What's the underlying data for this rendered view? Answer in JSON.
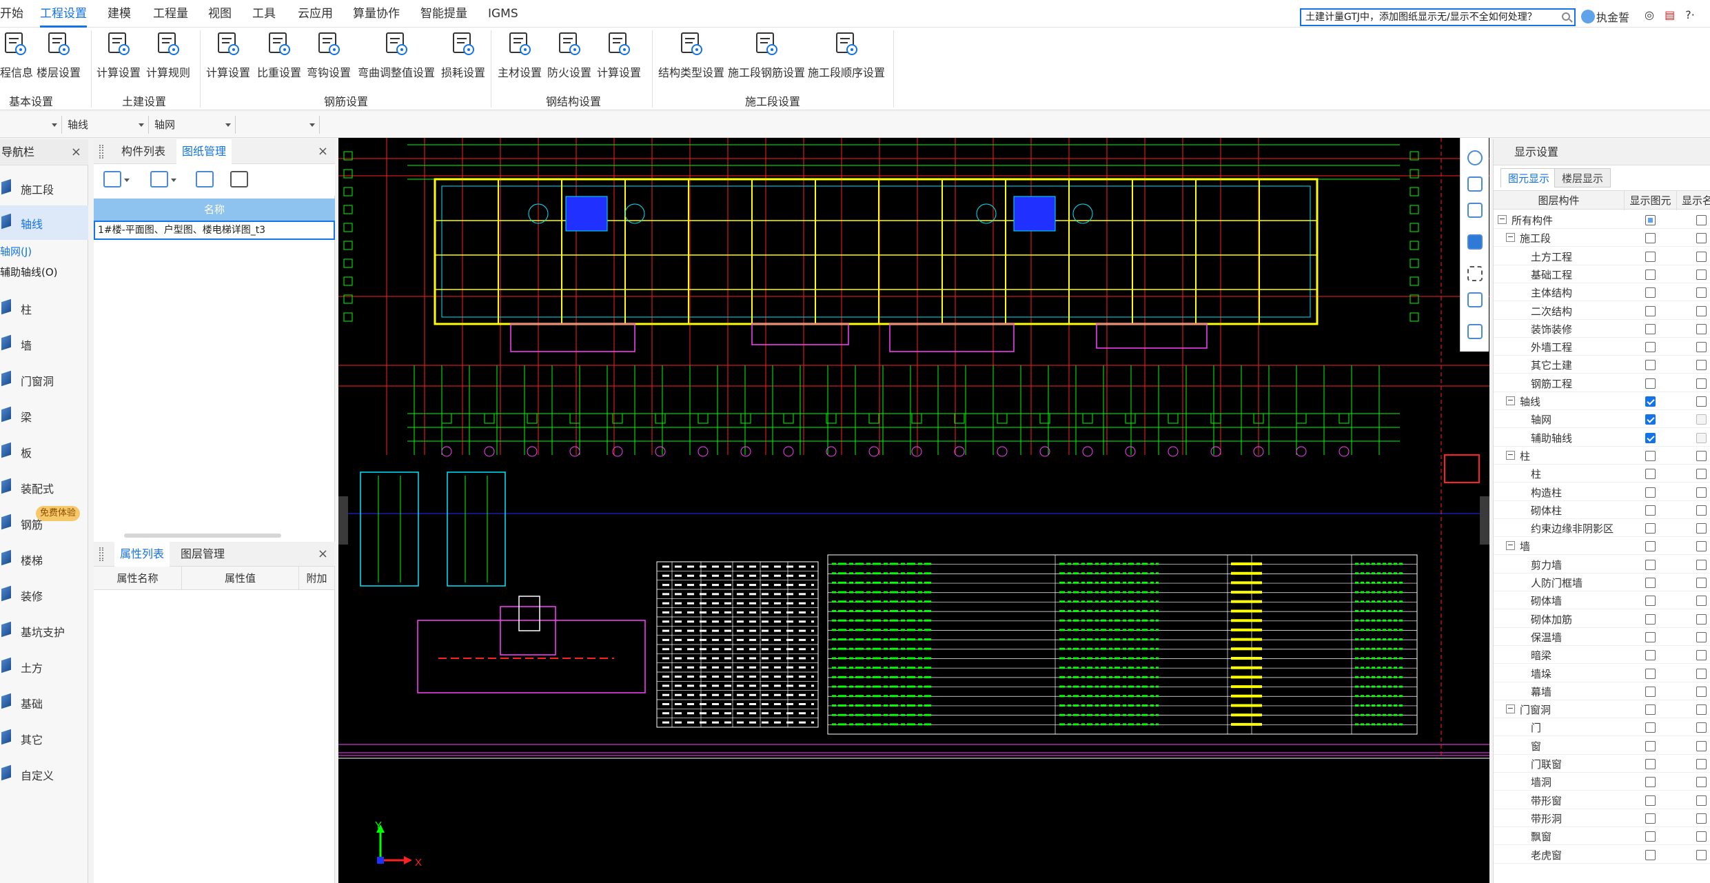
{
  "menu": [
    {
      "label": "开始",
      "active": false
    },
    {
      "label": "工程设置",
      "active": true
    },
    {
      "label": "建模",
      "active": false
    },
    {
      "label": "工程量",
      "active": false
    },
    {
      "label": "视图",
      "active": false
    },
    {
      "label": "工具",
      "active": false
    },
    {
      "label": "云应用",
      "active": false
    },
    {
      "label": "算量协作",
      "active": false
    },
    {
      "label": "智能提量",
      "active": false
    },
    {
      "label": "IGMS",
      "active": false
    }
  ],
  "search": {
    "value": "土建计量GTJ中，添加图纸显示无/显示不全如何处理？"
  },
  "user": {
    "name": "执金誓"
  },
  "toolbar_icons": {
    "headset": "◎",
    "app": "▤",
    "user": "♙",
    "help": "?·"
  },
  "ribbon": {
    "buttons": [
      {
        "label": "程信息",
        "icon": "project-info-icon"
      },
      {
        "label": "楼层设置",
        "icon": "floor-settings-icon"
      },
      {
        "label": "计算设置",
        "icon": "calc-settings-icon"
      },
      {
        "label": "计算规则",
        "icon": "calc-rules-icon"
      },
      {
        "label": "计算设置",
        "icon": "rebar-calc-settings-icon"
      },
      {
        "label": "比重设置",
        "icon": "weight-settings-icon"
      },
      {
        "label": "弯钩设置",
        "icon": "hook-settings-icon"
      },
      {
        "label": "弯曲调整值设置",
        "icon": "bend-adjust-icon"
      },
      {
        "label": "损耗设置",
        "icon": "loss-settings-icon"
      },
      {
        "label": "主材设置",
        "icon": "main-material-icon"
      },
      {
        "label": "防火设置",
        "icon": "fireproof-icon"
      },
      {
        "label": "计算设置",
        "icon": "steel-calc-settings-icon"
      },
      {
        "label": "结构类型设置",
        "icon": "structure-type-icon"
      },
      {
        "label": "施工段钢筋设置",
        "icon": "segment-rebar-icon"
      },
      {
        "label": "施工段顺序设置",
        "icon": "segment-order-icon"
      }
    ],
    "groups": [
      "基本设置",
      "土建设置",
      "钢筋设置",
      "钢结构设置",
      "施工段设置"
    ]
  },
  "selectors": [
    "",
    "轴线",
    "轴网",
    ""
  ],
  "leftnav": {
    "title": "导航栏",
    "close": "×",
    "items": [
      "施工段",
      "轴线",
      "柱",
      "墙",
      "门窗洞",
      "梁",
      "板",
      "装配式",
      "钢筋",
      "楼梯",
      "装修",
      "基坑支护",
      "土方",
      "基础",
      "其它",
      "自定义"
    ],
    "subitems": [
      "轴网(J)",
      "辅助轴线(O)"
    ],
    "badge": "免费体验"
  },
  "midpanel": {
    "tabs_top": [
      "构件列表",
      "图纸管理"
    ],
    "close": "×",
    "drawing_header": "名称",
    "drawing_row": "1#楼-平面图、户型图、楼电梯详图_t3",
    "tabs_bottom": [
      "属性列表",
      "图层管理"
    ],
    "prop_headers": [
      "属性名称",
      "属性值",
      "附加"
    ]
  },
  "rightpanel": {
    "title": "显示设置",
    "tabs": [
      "图元显示",
      "楼层显示"
    ],
    "headers": [
      "图层构件",
      "显示图元",
      "显示名"
    ],
    "tree": [
      {
        "label": "所有构件",
        "level": 0,
        "exp": "−",
        "show": "partial"
      },
      {
        "label": "施工段",
        "level": 1,
        "exp": "−",
        "show": "off"
      },
      {
        "label": "土方工程",
        "level": 2,
        "show": "off"
      },
      {
        "label": "基础工程",
        "level": 2,
        "show": "off"
      },
      {
        "label": "主体结构",
        "level": 2,
        "show": "off"
      },
      {
        "label": "二次结构",
        "level": 2,
        "show": "off"
      },
      {
        "label": "装饰装修",
        "level": 2,
        "show": "off"
      },
      {
        "label": "外墙工程",
        "level": 2,
        "show": "off"
      },
      {
        "label": "其它土建",
        "level": 2,
        "show": "off"
      },
      {
        "label": "钢筋工程",
        "level": 2,
        "show": "off"
      },
      {
        "label": "轴线",
        "level": 1,
        "exp": "−",
        "show": "on"
      },
      {
        "label": "轴网",
        "level": 2,
        "show": "on"
      },
      {
        "label": "辅助轴线",
        "level": 2,
        "show": "on"
      },
      {
        "label": "柱",
        "level": 1,
        "exp": "−",
        "show": "off"
      },
      {
        "label": "柱",
        "level": 2,
        "show": "off"
      },
      {
        "label": "构造柱",
        "level": 2,
        "show": "off"
      },
      {
        "label": "砌体柱",
        "level": 2,
        "show": "off"
      },
      {
        "label": "约束边缘非阴影区",
        "level": 2,
        "show": "off"
      },
      {
        "label": "墙",
        "level": 1,
        "exp": "−",
        "show": "off"
      },
      {
        "label": "剪力墙",
        "level": 2,
        "show": "off"
      },
      {
        "label": "人防门框墙",
        "level": 2,
        "show": "off"
      },
      {
        "label": "砌体墙",
        "level": 2,
        "show": "off"
      },
      {
        "label": "砌体加筋",
        "level": 2,
        "show": "off"
      },
      {
        "label": "保温墙",
        "level": 2,
        "show": "off"
      },
      {
        "label": "暗梁",
        "level": 2,
        "show": "off"
      },
      {
        "label": "墙垛",
        "level": 2,
        "show": "off"
      },
      {
        "label": "幕墙",
        "level": 2,
        "show": "off"
      },
      {
        "label": "门窗洞",
        "level": 1,
        "exp": "−",
        "show": "off"
      },
      {
        "label": "门",
        "level": 2,
        "show": "off"
      },
      {
        "label": "窗",
        "level": 2,
        "show": "off"
      },
      {
        "label": "门联窗",
        "level": 2,
        "show": "off"
      },
      {
        "label": "墙洞",
        "level": 2,
        "show": "off"
      },
      {
        "label": "带形窗",
        "level": 2,
        "show": "off"
      },
      {
        "label": "带形洞",
        "level": 2,
        "show": "off"
      },
      {
        "label": "飘窗",
        "level": 2,
        "show": "off"
      },
      {
        "label": "老虎窗",
        "level": 2,
        "show": "off"
      }
    ]
  },
  "canvas": {
    "axis_y": "Y",
    "axis_x": "X",
    "colors": {
      "background": "#000000",
      "grid": "#ff2020",
      "wall": "#ffff00",
      "green": "#00ff00",
      "cyan": "#00e5ff",
      "magenta": "#ff40ff",
      "white": "#ffffff",
      "blue": "#2030ff"
    }
  }
}
